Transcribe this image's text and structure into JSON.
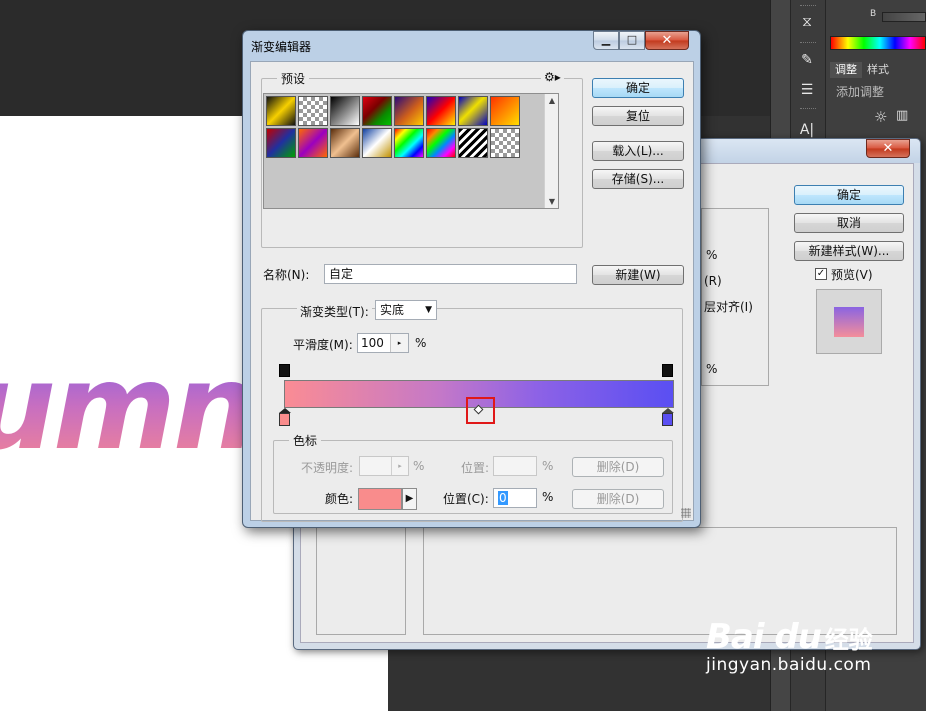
{
  "background_app": {
    "canvas_text": "umn",
    "panel": {
      "slider_label": "B",
      "tabs": [
        "调整",
        "样式"
      ],
      "adjust_label": "添加调整"
    },
    "icon_names": [
      "history-icon",
      "brush-icon",
      "adjust-icon",
      "text-icon"
    ]
  },
  "layer_style_dialog": {
    "buttons": {
      "ok": "确定",
      "cancel": "取消",
      "new_style": "新建样式(W)..."
    },
    "preview_checkbox": {
      "label": "预览(V)",
      "checked": true
    },
    "fragments": [
      "%",
      "(R)",
      "层对齐(I)",
      "%"
    ]
  },
  "gradient_editor": {
    "title": "渐变编辑器",
    "presets_legend": "预设",
    "buttons": {
      "ok": "确定",
      "reset": "复位",
      "load": "载入(L)...",
      "save": "存储(S)...",
      "new": "新建(W)"
    },
    "presets": [
      "linear-gradient(135deg,#111 0%,#f7d000 50%,#111 100%)",
      "repeating-conic-gradient(#999 0 25%,#fff 0 50%) 0 0/8px 8px",
      "linear-gradient(135deg,#000,#fff)",
      "linear-gradient(135deg,#e00010,#7a0000 40%,#0a8a00 70%,#00c000)",
      "linear-gradient(135deg,#2a0a7a,#d0601a 55%,#ffcc00)",
      "linear-gradient(135deg,#1a00c0,#ff0000 50%,#ffee00)",
      "linear-gradient(135deg,#0000c0,#f0e000 45%,#0000c0 100%)",
      "linear-gradient(135deg,#ff3300,#ffdd00)",
      "linear-gradient(135deg,#c00000,#2030a0 50%,#00a000)",
      "linear-gradient(135deg,#ff6a00,#9a00c0 50%,#ff6a00)",
      "linear-gradient(135deg,#5a2d0c,#f0c090 50%,#5a2d0c)",
      "linear-gradient(135deg,#1040a0,#ffffff 50%,#c09000)",
      "linear-gradient(135deg,#f00,#ff0,#0f0,#0ff,#00f,#f0f)",
      "linear-gradient(135deg,#ff0000,#ff8800,#00ff00,#0088ff,#ff00ff,#ff0000)",
      "repeating-linear-gradient(135deg,#000 0 3px,#fff 3px 6px)",
      "repeating-conic-gradient(#999 0 25%,#fff 0 50%) 0 0/8px 8px"
    ],
    "name_label": "名称(N):",
    "name_value": "自定",
    "gradient_type_label": "渐变类型(T):",
    "gradient_type_value": "实底",
    "smoothness_label": "平滑度(M):",
    "smoothness_value": "100",
    "percent": "%",
    "gradient": {
      "start_color": "#fa8c94",
      "end_color": "#5a4ff2",
      "opacity_stops": [
        0,
        100
      ],
      "color_stops": [
        0,
        100
      ],
      "midpoint_selected": 50
    },
    "stops_legend": "色标",
    "opacity_label": "不透明度:",
    "opacity_value": "",
    "location_label_disabled": "位置:",
    "location_value_disabled": "",
    "delete_label": "删除(D)",
    "color_label": "颜色:",
    "color_value": "#f98c8c",
    "location_label": "位置(C):",
    "location_value": "0"
  },
  "watermark": {
    "logo": "Bai du",
    "brand_cn": "经验",
    "url": "jingyan.baidu.com"
  }
}
